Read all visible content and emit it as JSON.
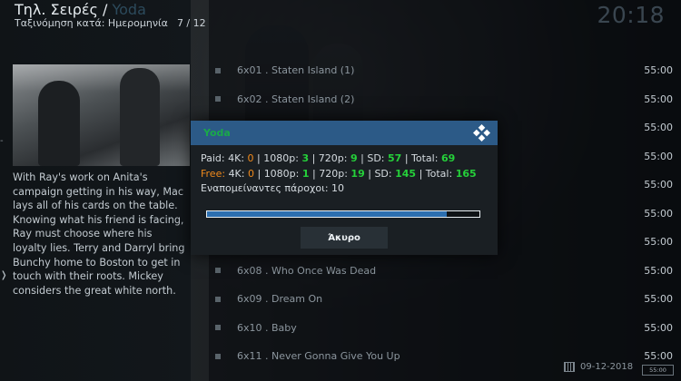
{
  "header": {
    "title": "Τηλ. Σειρές / ",
    "title_accent": "Yoda",
    "sort_label": "Ταξινόμηση κατά: Ημερομηνία",
    "position": "7 / 12",
    "clock": "20:18"
  },
  "plot": "With Ray's work on Anita's campaign getting in his way, Mac lays all of his cards on the table. Knowing what his friend is facing, Ray must choose where his loyalty lies. Terry and Darryl bring Bunchy home to Boston to get in touch with their roots. Mickey considers the great white north.",
  "episodes": [
    {
      "name": "6x01 . Staten Island (1)",
      "duration": "55:00"
    },
    {
      "name": "6x02 . Staten Island (2)",
      "duration": "55:00"
    },
    {
      "name": "",
      "duration": "55:00"
    },
    {
      "name": "",
      "duration": "55:00"
    },
    {
      "name": "",
      "duration": "55:00"
    },
    {
      "name": "",
      "duration": "55:00"
    },
    {
      "name": "",
      "duration": "55:00"
    },
    {
      "name": "6x08 . Who Once Was Dead",
      "duration": "55:00"
    },
    {
      "name": "6x09 . Dream On",
      "duration": "55:00"
    },
    {
      "name": "6x10 . Baby",
      "duration": "55:00"
    },
    {
      "name": "6x11 . Never Gonna Give You Up",
      "duration": "55:00"
    }
  ],
  "footer": {
    "date": "09-12-2018",
    "time": "55:00"
  },
  "dialog": {
    "title": "Yoda",
    "paid": {
      "label": "Paid:",
      "k4": "0",
      "p1080": "3",
      "p720": "9",
      "sd": "57",
      "total": "69"
    },
    "free": {
      "label": "Free:",
      "k4": "0",
      "p1080": "1",
      "p720": "19",
      "sd": "145",
      "total": "165"
    },
    "labels": {
      "k4": "4K:",
      "p1080": "1080p:",
      "p720": "720p:",
      "sd": "SD:",
      "total": "Total:"
    },
    "remaining_label": "Εναπομείναντες πάροχοι:",
    "remaining_value": "10",
    "progress": 0.88,
    "cancel_label": "Άκυρο"
  },
  "colors": {
    "dialog_header": "#2c5a87",
    "green": "#25d03a",
    "orange": "#f08a1c",
    "progress": "#2c6fb0"
  }
}
